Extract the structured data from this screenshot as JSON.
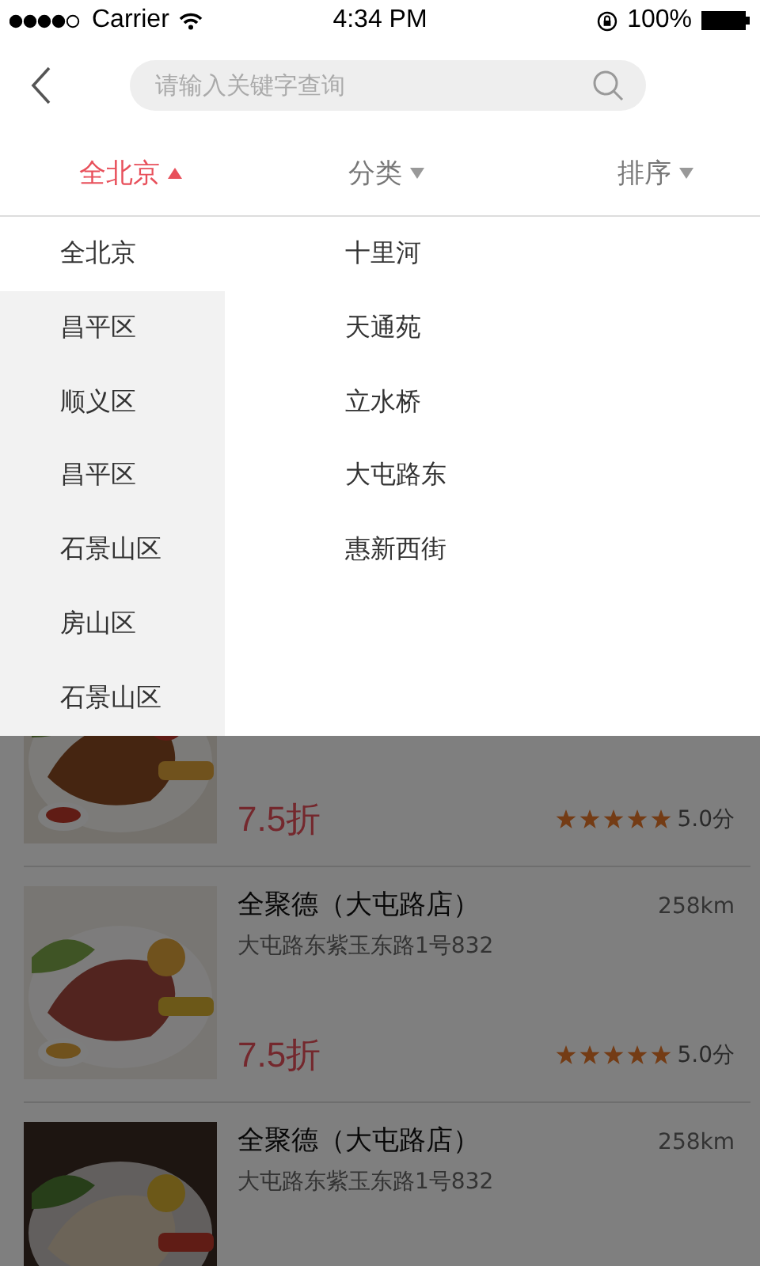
{
  "status_bar": {
    "carrier": "Carrier",
    "time": "4:34 PM",
    "battery": "100%"
  },
  "search": {
    "placeholder": "请输入关键字查询"
  },
  "filters": [
    {
      "label": "全北京",
      "selected": true
    },
    {
      "label": "分类",
      "selected": false
    },
    {
      "label": "排序",
      "selected": false
    }
  ],
  "districts": [
    {
      "label": "全北京",
      "selected": true
    },
    {
      "label": "昌平区",
      "selected": false
    },
    {
      "label": "顺义区",
      "selected": false
    },
    {
      "label": "昌平区",
      "selected": false
    },
    {
      "label": "石景山区",
      "selected": false
    },
    {
      "label": "房山区",
      "selected": false
    },
    {
      "label": "石景山区",
      "selected": false
    }
  ],
  "areas": [
    {
      "label": "十里河"
    },
    {
      "label": "天通苑"
    },
    {
      "label": "立水桥"
    },
    {
      "label": "大屯路东"
    },
    {
      "label": "惠新西街"
    }
  ],
  "restaurants": [
    {
      "kind": "partial",
      "discount": "7.5折",
      "stars": 5,
      "rating": "5.0分"
    },
    {
      "kind": "full",
      "name": "全聚德（大屯路店）",
      "distance": "258km",
      "address": "大屯路东紫玉东路1号832",
      "discount": "7.5折",
      "stars": 5,
      "rating": "5.0分"
    },
    {
      "kind": "cut",
      "name": "全聚德（大屯路店）",
      "distance": "258km",
      "address": "大屯路东紫玉东路1号832"
    }
  ]
}
